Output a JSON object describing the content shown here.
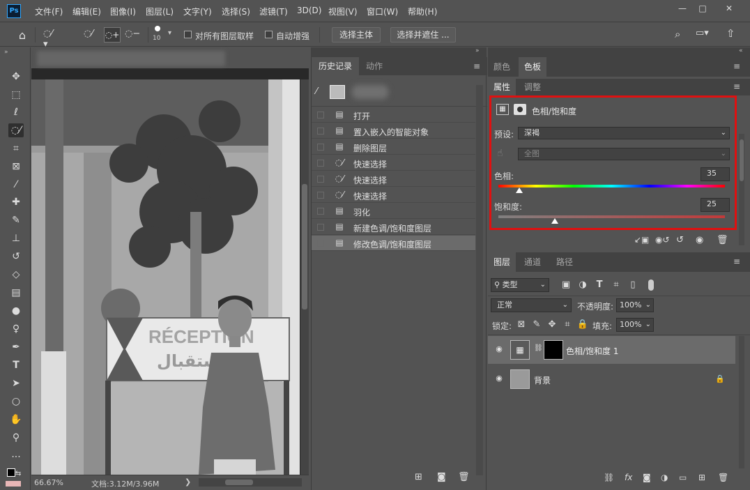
{
  "app": {
    "logo": "Ps"
  },
  "menu": {
    "items": [
      "文件(F)",
      "编辑(E)",
      "图像(I)",
      "图层(L)",
      "文字(Y)",
      "选择(S)",
      "滤镜(T)",
      "3D(D)",
      "视图(V)",
      "窗口(W)",
      "帮助(H)"
    ]
  },
  "window": {
    "minimize": "—",
    "maximize": "□",
    "close": "✕"
  },
  "options": {
    "brush_size": "10",
    "sample_all_layers": "对所有图层取样",
    "auto_enhance": "自动增强",
    "select_subject": "选择主体",
    "select_and_mask": "选择并遮住 ..."
  },
  "canvas": {
    "sign_text": "RÉCEPTION",
    "sign_arabic": "استقبال"
  },
  "status": {
    "zoom": "66.67%",
    "doc": "文档:3.12M/3.96M",
    "arrow": "❯"
  },
  "history": {
    "tabs": [
      "历史记录",
      "动作"
    ],
    "items": [
      {
        "label": "打开",
        "icon": "doc-icon"
      },
      {
        "label": "置入嵌入的智能对象",
        "icon": "doc-icon"
      },
      {
        "label": "删除图层",
        "icon": "doc-icon"
      },
      {
        "label": "快速选择",
        "icon": "quick-select-icon"
      },
      {
        "label": "快速选择",
        "icon": "quick-select-icon"
      },
      {
        "label": "快速选择",
        "icon": "quick-select-icon"
      },
      {
        "label": "羽化",
        "icon": "doc-icon"
      },
      {
        "label": "新建色调/饱和度图层",
        "icon": "doc-icon"
      },
      {
        "label": "修改色调/饱和度图层",
        "icon": "doc-icon"
      }
    ]
  },
  "color_panel": {
    "tabs": [
      "颜色",
      "色板"
    ]
  },
  "properties": {
    "tabs": [
      "属性",
      "调整"
    ],
    "title": "色相/饱和度",
    "preset_label": "预设:",
    "preset_value": "深褐",
    "channel_value": "全图",
    "hue_label": "色相:",
    "hue_value": "35",
    "saturation_label": "饱和度:",
    "saturation_value": "25"
  },
  "layers": {
    "tabs": [
      "图层",
      "通道",
      "路径"
    ],
    "filter_kind": "类型",
    "blend_mode": "正常",
    "opacity_label": "不透明度:",
    "opacity_value": "100%",
    "lock_label": "锁定:",
    "fill_label": "填充:",
    "fill_value": "100%",
    "items": [
      {
        "name": "色相/饱和度 1",
        "selected": true
      },
      {
        "name": "背景",
        "selected": false
      }
    ]
  },
  "colors": {
    "accent_red": "#e01010",
    "panel": "#535353",
    "selected_row": "#6b6b6b"
  }
}
